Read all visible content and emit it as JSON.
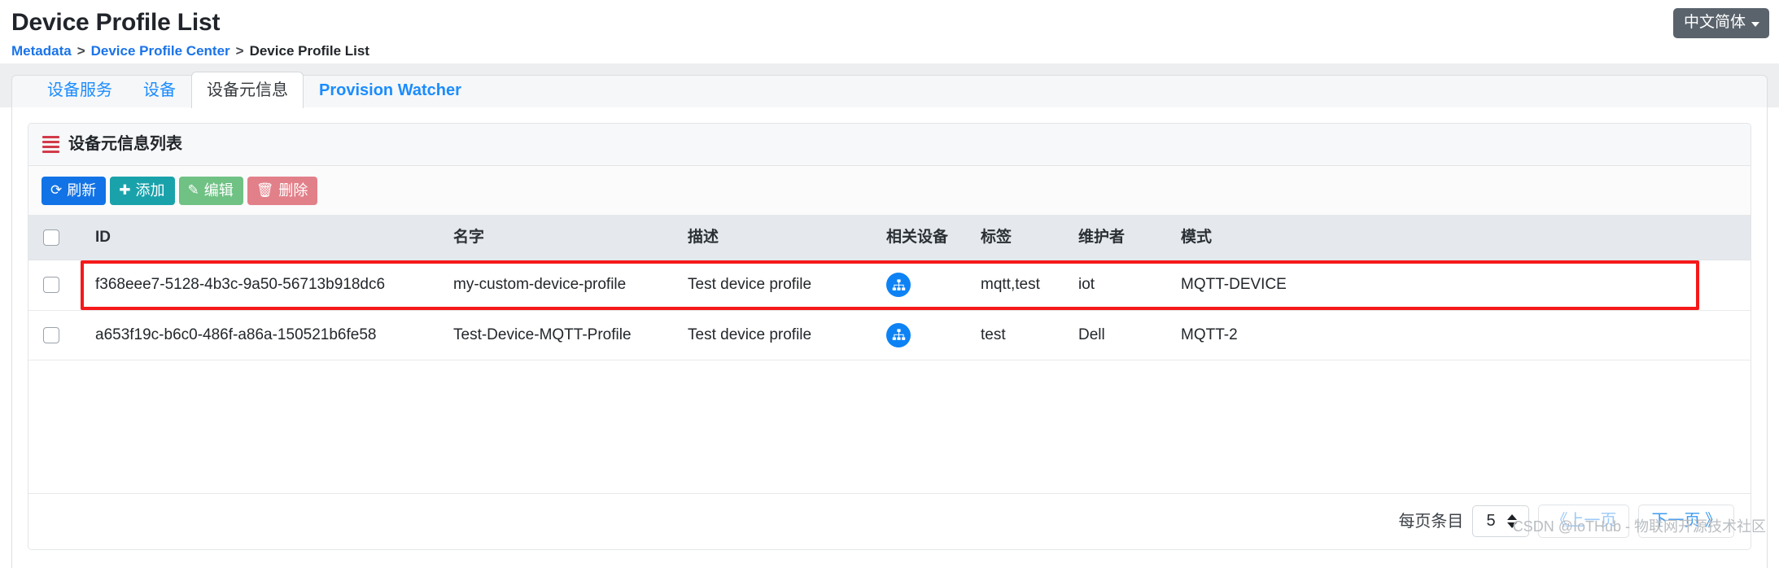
{
  "header": {
    "title": "Device Profile List",
    "breadcrumb": [
      {
        "label": "Metadata",
        "link": true
      },
      {
        "label": ">",
        "link": false
      },
      {
        "label": "Device Profile Center",
        "link": true
      },
      {
        "label": ">",
        "link": false
      },
      {
        "label": "Device Profile List",
        "link": false
      }
    ],
    "crumb1": "Metadata",
    "sep1": ">",
    "crumb2": "Device Profile Center",
    "sep2": ">",
    "crumb3": "Device Profile List",
    "language_button": "中文简体"
  },
  "tabs": [
    {
      "label": "设备服务",
      "active": false,
      "bold": false
    },
    {
      "label": "设备",
      "active": false,
      "bold": false
    },
    {
      "label": "设备元信息",
      "active": true,
      "bold": false
    },
    {
      "label": "Provision Watcher",
      "active": false,
      "bold": true
    }
  ],
  "card": {
    "title": "设备元信息列表",
    "icon": "list-ul-icon"
  },
  "toolbar": {
    "buttons": [
      {
        "label": "刷新",
        "glyph": "⟳",
        "icon": "refresh-icon",
        "color": "#1273e6"
      },
      {
        "label": "添加",
        "glyph": "✚",
        "icon": "plus-icon",
        "color": "#1aa2ab"
      },
      {
        "label": "编辑",
        "glyph": "✎",
        "icon": "edit-icon",
        "color": "#6fc184"
      },
      {
        "label": "删除",
        "glyph": "🗑",
        "icon": "trash-icon",
        "color": "#e28089"
      }
    ]
  },
  "table": {
    "columns": [
      {
        "key": "check",
        "label": ""
      },
      {
        "key": "id",
        "label": "ID"
      },
      {
        "key": "name",
        "label": "名字"
      },
      {
        "key": "desc",
        "label": "描述"
      },
      {
        "key": "rel",
        "label": "相关设备"
      },
      {
        "key": "tag",
        "label": "标签"
      },
      {
        "key": "owner",
        "label": "维护者"
      },
      {
        "key": "model",
        "label": "模式"
      }
    ],
    "rows": [
      {
        "id": "f368eee7-5128-4b3c-9a50-56713b918dc6",
        "name": "my-custom-device-profile",
        "desc": "Test device profile",
        "rel_icon": "sitemap-icon",
        "tag": "mqtt,test",
        "owner": "iot",
        "model": "MQTT-DEVICE",
        "highlighted": true
      },
      {
        "id": "a653f19c-b6c0-486f-a86a-150521b6fe58",
        "name": "Test-Device-MQTT-Profile",
        "desc": "Test device profile",
        "rel_icon": "sitemap-icon",
        "tag": "test",
        "owner": "Dell",
        "model": "MQTT-2",
        "highlighted": false
      }
    ]
  },
  "pagination": {
    "per_page_label": "每页条目",
    "per_page_value": "5",
    "prev_label": "《上一页",
    "next_label": "下一页 》"
  },
  "watermark": "CSDN @IoTHub - 物联网开源技术社区",
  "colors": {
    "accent_blue": "#1a8cff",
    "highlight_red": "#f5191a",
    "header_bg": "#e5e9ed",
    "lang_btn_bg": "#5a636c",
    "rel_icon_bg": "#0d82f5",
    "card_icon_red": "#d23b4a"
  }
}
